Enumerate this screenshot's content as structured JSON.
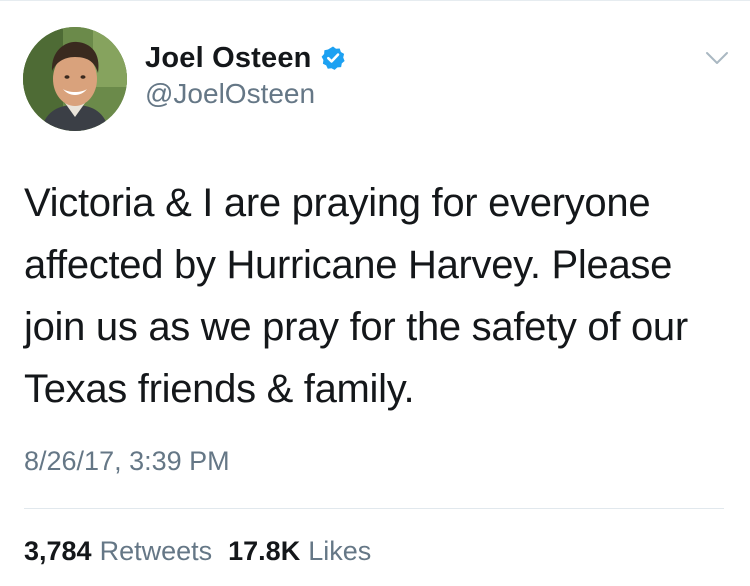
{
  "tweet": {
    "author": {
      "display_name": "Joel Osteen",
      "handle": "@JoelOsteen",
      "verified": true
    },
    "text_lines": [
      "Victoria & I are praying for everyone",
      "affected by Hurricane Harvey. Please",
      "join us as we pray for the safety of our",
      "Texas friends & family."
    ],
    "timestamp": "8/26/17, 3:39 PM",
    "stats": {
      "retweets_count": "3,784",
      "retweets_label": "Retweets",
      "likes_count": "17.8K",
      "likes_label": "Likes"
    }
  },
  "icons": {
    "verified": "verified-badge-icon",
    "menu": "chevron-down-icon"
  },
  "colors": {
    "verified_blue": "#1da1f2",
    "text_primary": "#14171a",
    "text_secondary": "#657786"
  }
}
